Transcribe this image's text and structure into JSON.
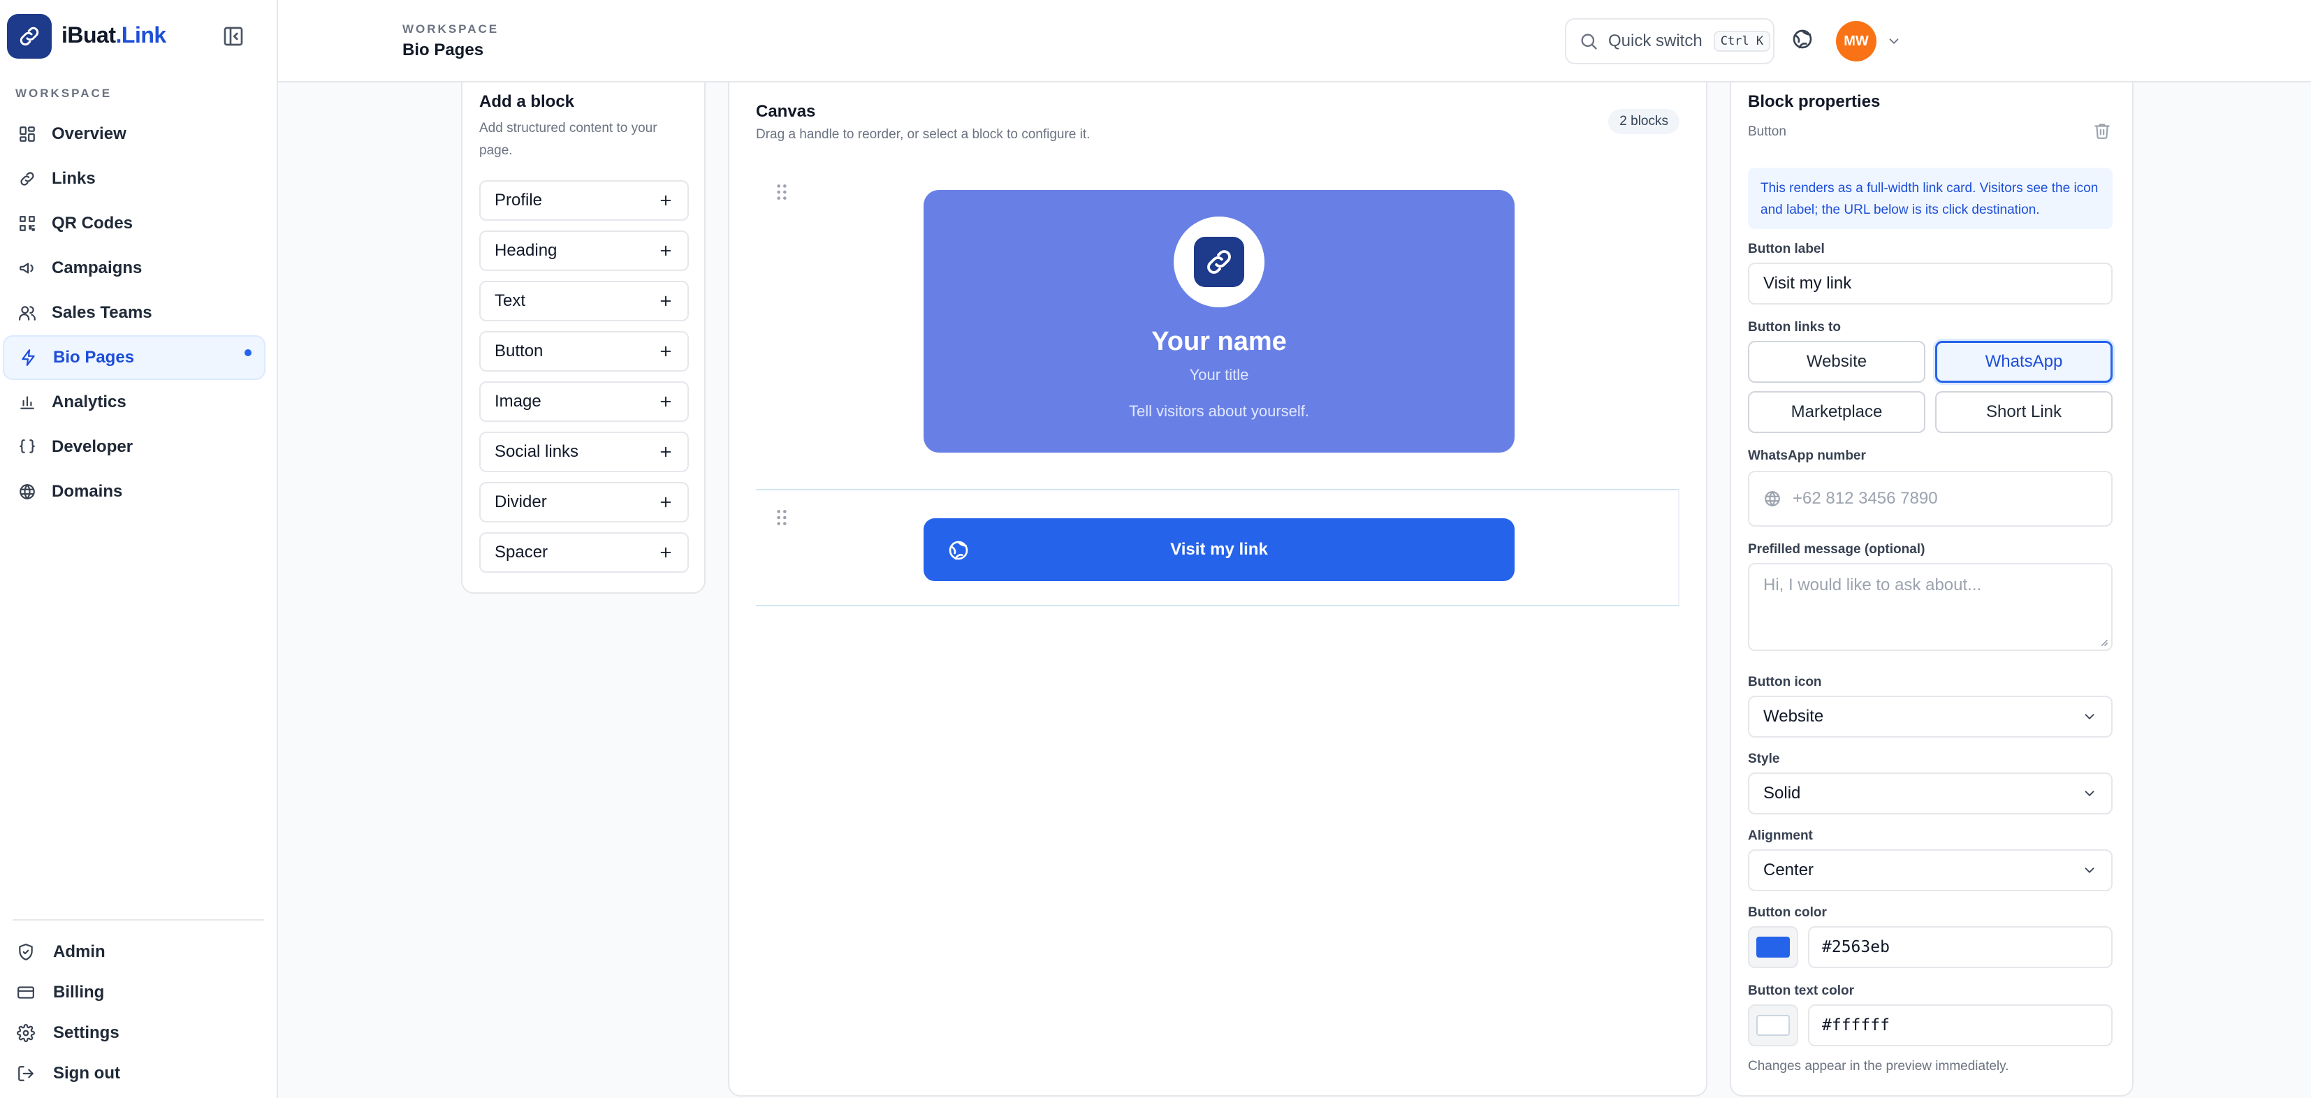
{
  "app": {
    "brand_name": "iBuat",
    "brand_tld": ".Link"
  },
  "sidebar": {
    "section_label": "WORKSPACE",
    "items": [
      {
        "label": "Overview",
        "icon": "grid-icon"
      },
      {
        "label": "Links",
        "icon": "link-icon"
      },
      {
        "label": "QR Codes",
        "icon": "qr-code-icon"
      },
      {
        "label": "Campaigns",
        "icon": "megaphone-icon"
      },
      {
        "label": "Sales Teams",
        "icon": "users-icon"
      },
      {
        "label": "Bio Pages",
        "icon": "lightning-icon",
        "active": true
      },
      {
        "label": "Analytics",
        "icon": "bar-chart-icon"
      },
      {
        "label": "Developer",
        "icon": "braces-icon"
      },
      {
        "label": "Domains",
        "icon": "globe-icon"
      }
    ],
    "bottom_items": [
      {
        "label": "Admin",
        "icon": "shield-icon"
      },
      {
        "label": "Billing",
        "icon": "credit-card-icon"
      },
      {
        "label": "Settings",
        "icon": "gear-icon"
      },
      {
        "label": "Sign out",
        "icon": "sign-out-icon"
      }
    ]
  },
  "header": {
    "breadcrumb_label": "WORKSPACE",
    "page_title": "Bio Pages",
    "quick_switch": "Quick switch",
    "shortcut": "Ctrl K",
    "avatar_initials": "MW"
  },
  "add_block": {
    "title": "Add a block",
    "subtitle": "Add structured content to your page.",
    "items": [
      "Profile",
      "Heading",
      "Text",
      "Button",
      "Image",
      "Social links",
      "Divider",
      "Spacer"
    ]
  },
  "canvas": {
    "title": "Canvas",
    "subtitle": "Drag a handle to reorder, or select a block to configure it.",
    "block_count": "2 blocks",
    "profile": {
      "name": "Your name",
      "title": "Your title",
      "bio": "Tell visitors about yourself."
    },
    "button_label": "Visit my link"
  },
  "properties": {
    "title": "Block properties",
    "block_type": "Button",
    "info": "This renders as a full-width link card. Visitors see the icon and label; the URL below is its click destination.",
    "label_label": "Button label",
    "label_value": "Visit my link",
    "links_to_label": "Button links to",
    "link_options": [
      "Website",
      "WhatsApp",
      "Marketplace",
      "Short Link"
    ],
    "selected_link": "WhatsApp",
    "whatsapp_label": "WhatsApp number",
    "whatsapp_placeholder": "+62 812 3456 7890",
    "message_label": "Prefilled message (optional)",
    "message_placeholder": "Hi, I would like to ask about...",
    "icon_label": "Button icon",
    "icon_value": "Website",
    "style_label": "Style",
    "style_value": "Solid",
    "alignment_label": "Alignment",
    "alignment_value": "Center",
    "color_label": "Button color",
    "color_value": "#2563eb",
    "text_color_label": "Button text color",
    "text_color_value": "#ffffff",
    "note": "Changes appear in the preview immediately."
  },
  "colors": {
    "accent": "#2563eb",
    "profile_card": "#6880e6",
    "avatar": "#f97316"
  }
}
